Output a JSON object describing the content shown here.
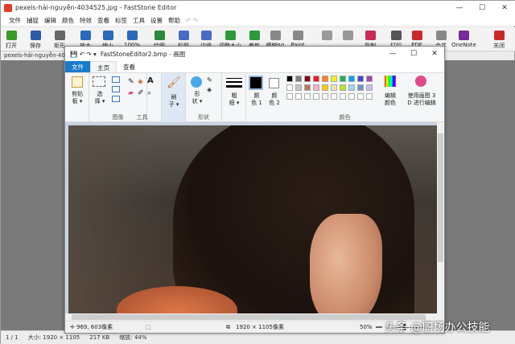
{
  "fs": {
    "title": "pexels-hải-nguyễn-4034525.jpg - FastStone Editor",
    "menu": [
      "文件",
      "捕捉",
      "编辑",
      "颜色",
      "特效",
      "查看",
      "标签",
      "工具",
      "设置",
      "帮助"
    ],
    "undo": "↶ ↷",
    "toolbar": [
      {
        "label": "打开",
        "color": "#3a9a2a"
      },
      {
        "label": "保存",
        "color": "#2a5aa8"
      },
      {
        "label": "矩形",
        "color": "#666"
      },
      {
        "label": "放大",
        "color": "#2a6ab8"
      },
      {
        "label": "缩小",
        "color": "#2a6ab8"
      },
      {
        "label": "100%",
        "color": "#2a6ab8"
      },
      {
        "label": "绘图",
        "color": "#2a8a3a"
      },
      {
        "label": "标题",
        "color": "#4a6ac8"
      },
      {
        "label": "边缘",
        "color": "#4a6ac8"
      },
      {
        "label": "调整大小",
        "color": "#2a9a3a"
      },
      {
        "label": "裁剪",
        "color": "#2a9a3a"
      },
      {
        "label": "模糊50",
        "color": "#888"
      },
      {
        "label": "Paint",
        "color": "#888"
      },
      {
        "label": "",
        "color": "#999"
      },
      {
        "label": "",
        "color": "#999"
      },
      {
        "label": "复制",
        "color": "#c82a5a"
      },
      {
        "label": "打印",
        "color": "#555"
      },
      {
        "label": "PDF",
        "color": "#c82a2a"
      },
      {
        "label": "合并",
        "color": "#888"
      },
      {
        "label": "OneNote",
        "color": "#7a2a9a"
      },
      {
        "label": "关闭",
        "color": "#c82a2a"
      }
    ],
    "file_tab": "pexels-hải-nguyễn-403",
    "status": {
      "page": "1 / 1",
      "size": "大小:  1920 × 1105",
      "kb": "217 KB",
      "zoom": "缩放:  44%"
    }
  },
  "paint": {
    "title": "FastStoneEditor2.bmp - 画图",
    "quick": "💾 ↶ ↷ ▾",
    "tabs": [
      "文件",
      "主页",
      "查看"
    ],
    "groups": {
      "clipboard": "剪贴\n板 ▾",
      "select": "选\n择 ▾",
      "image": "图像",
      "tools": "工具",
      "brush": "刷\n子 ▾",
      "shapes_btn": "形\n状 ▾",
      "shapes": "形状",
      "size": "粗\n细 ▾",
      "color1": "颜\n色 1",
      "color2": "颜\n色 2",
      "edit_colors": "编辑\n颜色",
      "paint3d": "使用画图 3\nD 进行编辑",
      "colors": "颜色"
    },
    "palette_row1": [
      "#000000",
      "#7f7f7f",
      "#880015",
      "#ed1c24",
      "#ff7f27",
      "#fff200",
      "#22b14c",
      "#00a2e8",
      "#3f48cc",
      "#a349a4"
    ],
    "palette_row2": [
      "#ffffff",
      "#c3c3c3",
      "#b97a57",
      "#ffaec9",
      "#ffc90e",
      "#efe4b0",
      "#b5e61d",
      "#99d9ea",
      "#7092be",
      "#c8bfe7"
    ],
    "status": {
      "cursor": "969, 603像素",
      "size": "1920 × 1105像素",
      "zoom": "50%"
    }
  },
  "watermark": "头条 @职场办公技能"
}
